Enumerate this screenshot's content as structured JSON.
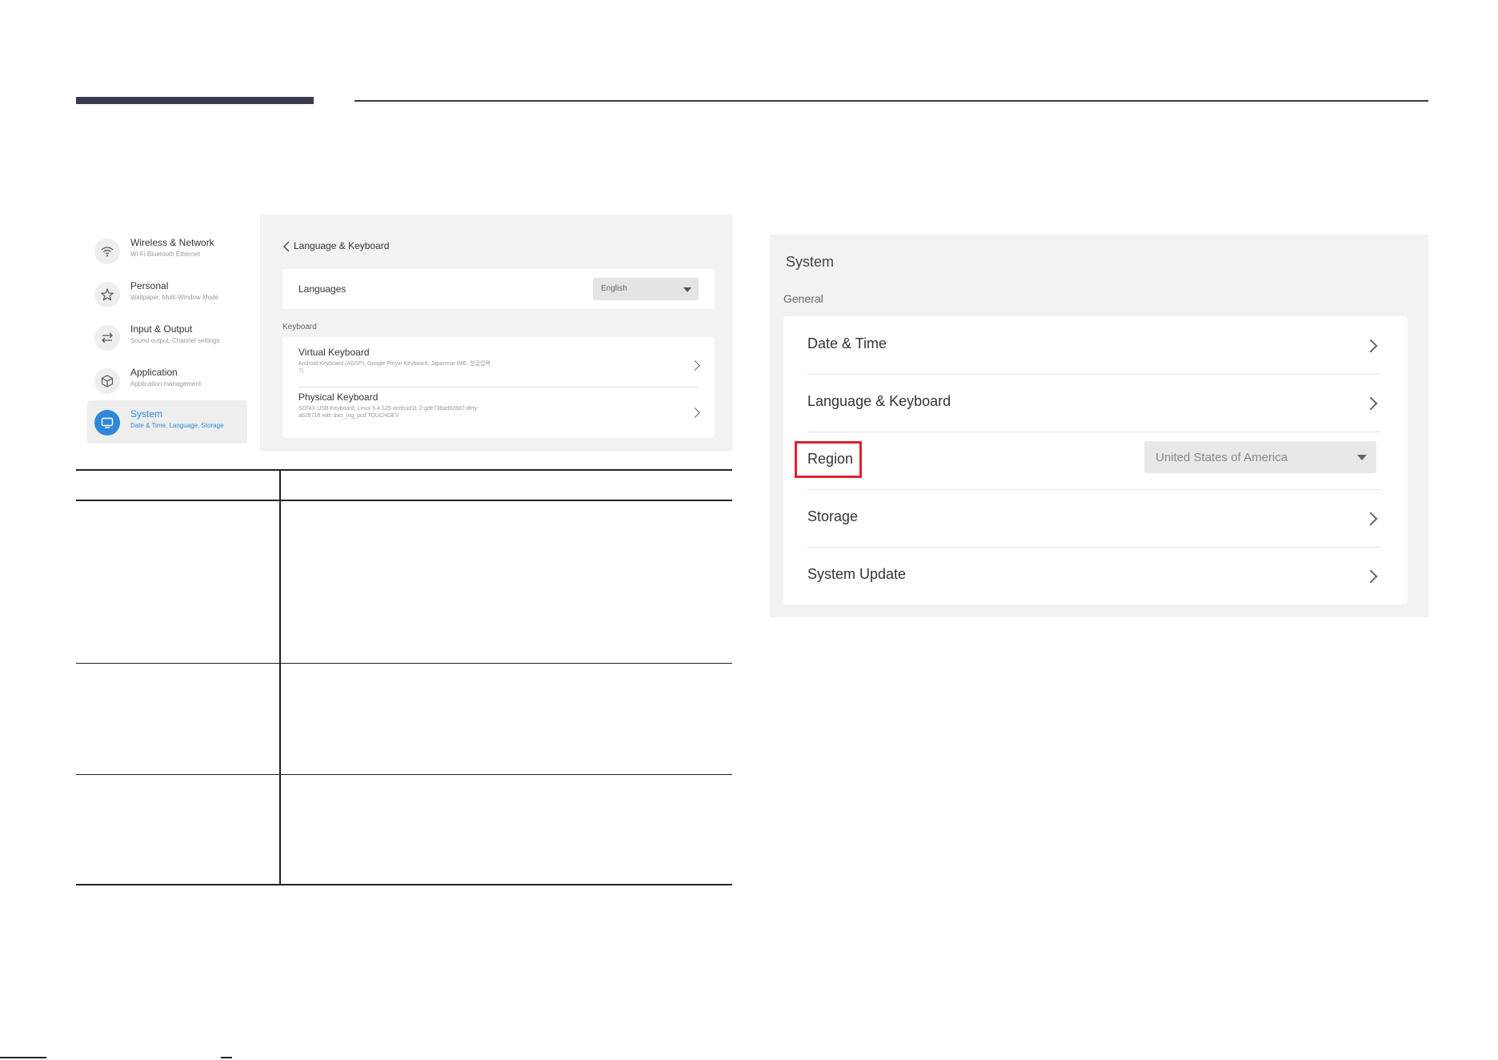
{
  "sidebar": {
    "items": [
      {
        "title": "Wireless & Network",
        "subtitle": "Wi-Fi Bluetooth Ethernet",
        "icon": "wifi-icon"
      },
      {
        "title": "Personal",
        "subtitle": "Wallpaper, Multi-Window Mode",
        "icon": "star-icon"
      },
      {
        "title": "Input & Output",
        "subtitle": "Sound output, Channel settings",
        "icon": "swap-arrows-icon"
      },
      {
        "title": "Application",
        "subtitle": "Application management",
        "icon": "box-icon"
      },
      {
        "title": "System",
        "subtitle": "Date & Time, Language, Storage",
        "icon": "monitor-icon",
        "active": true
      }
    ]
  },
  "language_panel": {
    "back_title": "Language & Keyboard",
    "languages_label": "Languages",
    "languages_value": "English",
    "keyboard_header": "Keyboard",
    "virtual_keyboard": {
      "title": "Virtual Keyboard",
      "subtitle": "Android Keyboard (AOSP), Google Pinyin Keyboard, Japanese IME, 한글입력기"
    },
    "physical_keyboard": {
      "title": "Physical Keyboard",
      "subtitle": "SONiX USB Keyboard, Linux 5.4.125-android11-2-gde738ad928d7-dirty-ab28716 with dwc_ing_pcd TOUCHDEV"
    }
  },
  "system_panel": {
    "title": "System",
    "section": "General",
    "rows": [
      {
        "label": "Date & Time"
      },
      {
        "label": "Language & Keyboard"
      },
      {
        "label": "Region",
        "value": "United States of America",
        "highlighted": true
      },
      {
        "label": "Storage"
      },
      {
        "label": "System Update"
      }
    ]
  },
  "colors": {
    "accent": "#2f88d8",
    "highlight_box": "#d9232e",
    "rule": "#3a3a4e"
  }
}
